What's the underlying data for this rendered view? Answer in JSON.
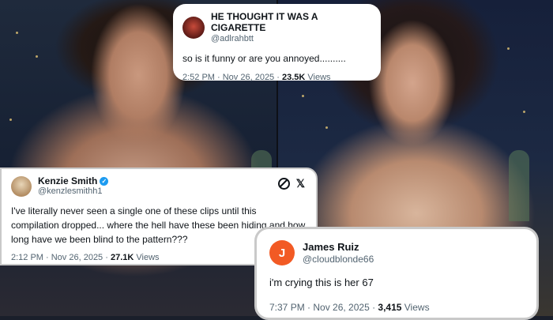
{
  "tweets": {
    "top": {
      "display_name": "HE THOUGHT IT WAS A CIGARETTE",
      "handle": "@adlrahbtt",
      "text": "so is it funny or are you annoyed..........",
      "time": "2:52 PM · Nov 26, 2025 · ",
      "views_count": "23.5K",
      "views_label": " Views",
      "avatar_icon": "profile-photo-icon"
    },
    "left": {
      "display_name": "Kenzie Smith",
      "handle": "@kenzlesmithh1",
      "text": "I've literally never seen a single one of these clips until this compilation dropped... where the hell have these been hiding and how long have we been blind to the pattern???",
      "time": "2:12 PM · Nov 26, 2025 · ",
      "views_count": "27.1K",
      "views_label": " Views",
      "verified_icon": "verified-badge-icon",
      "actions": [
        "grok-icon",
        "x-logo-icon"
      ],
      "x_logo": "𝕏"
    },
    "right": {
      "display_name": "James Ruiz",
      "handle": "@cloudblonde66",
      "avatar_letter": "J",
      "text": "i'm crying this is her 67",
      "time": "7:37 PM · Nov 26, 2025 · ",
      "views_count": "3,415",
      "views_label": " Views"
    }
  },
  "colors": {
    "accent_blue": "#1d9bf0",
    "avatar_orange": "#f25a24",
    "muted_text": "#536471",
    "card_bg": "#ffffff"
  }
}
